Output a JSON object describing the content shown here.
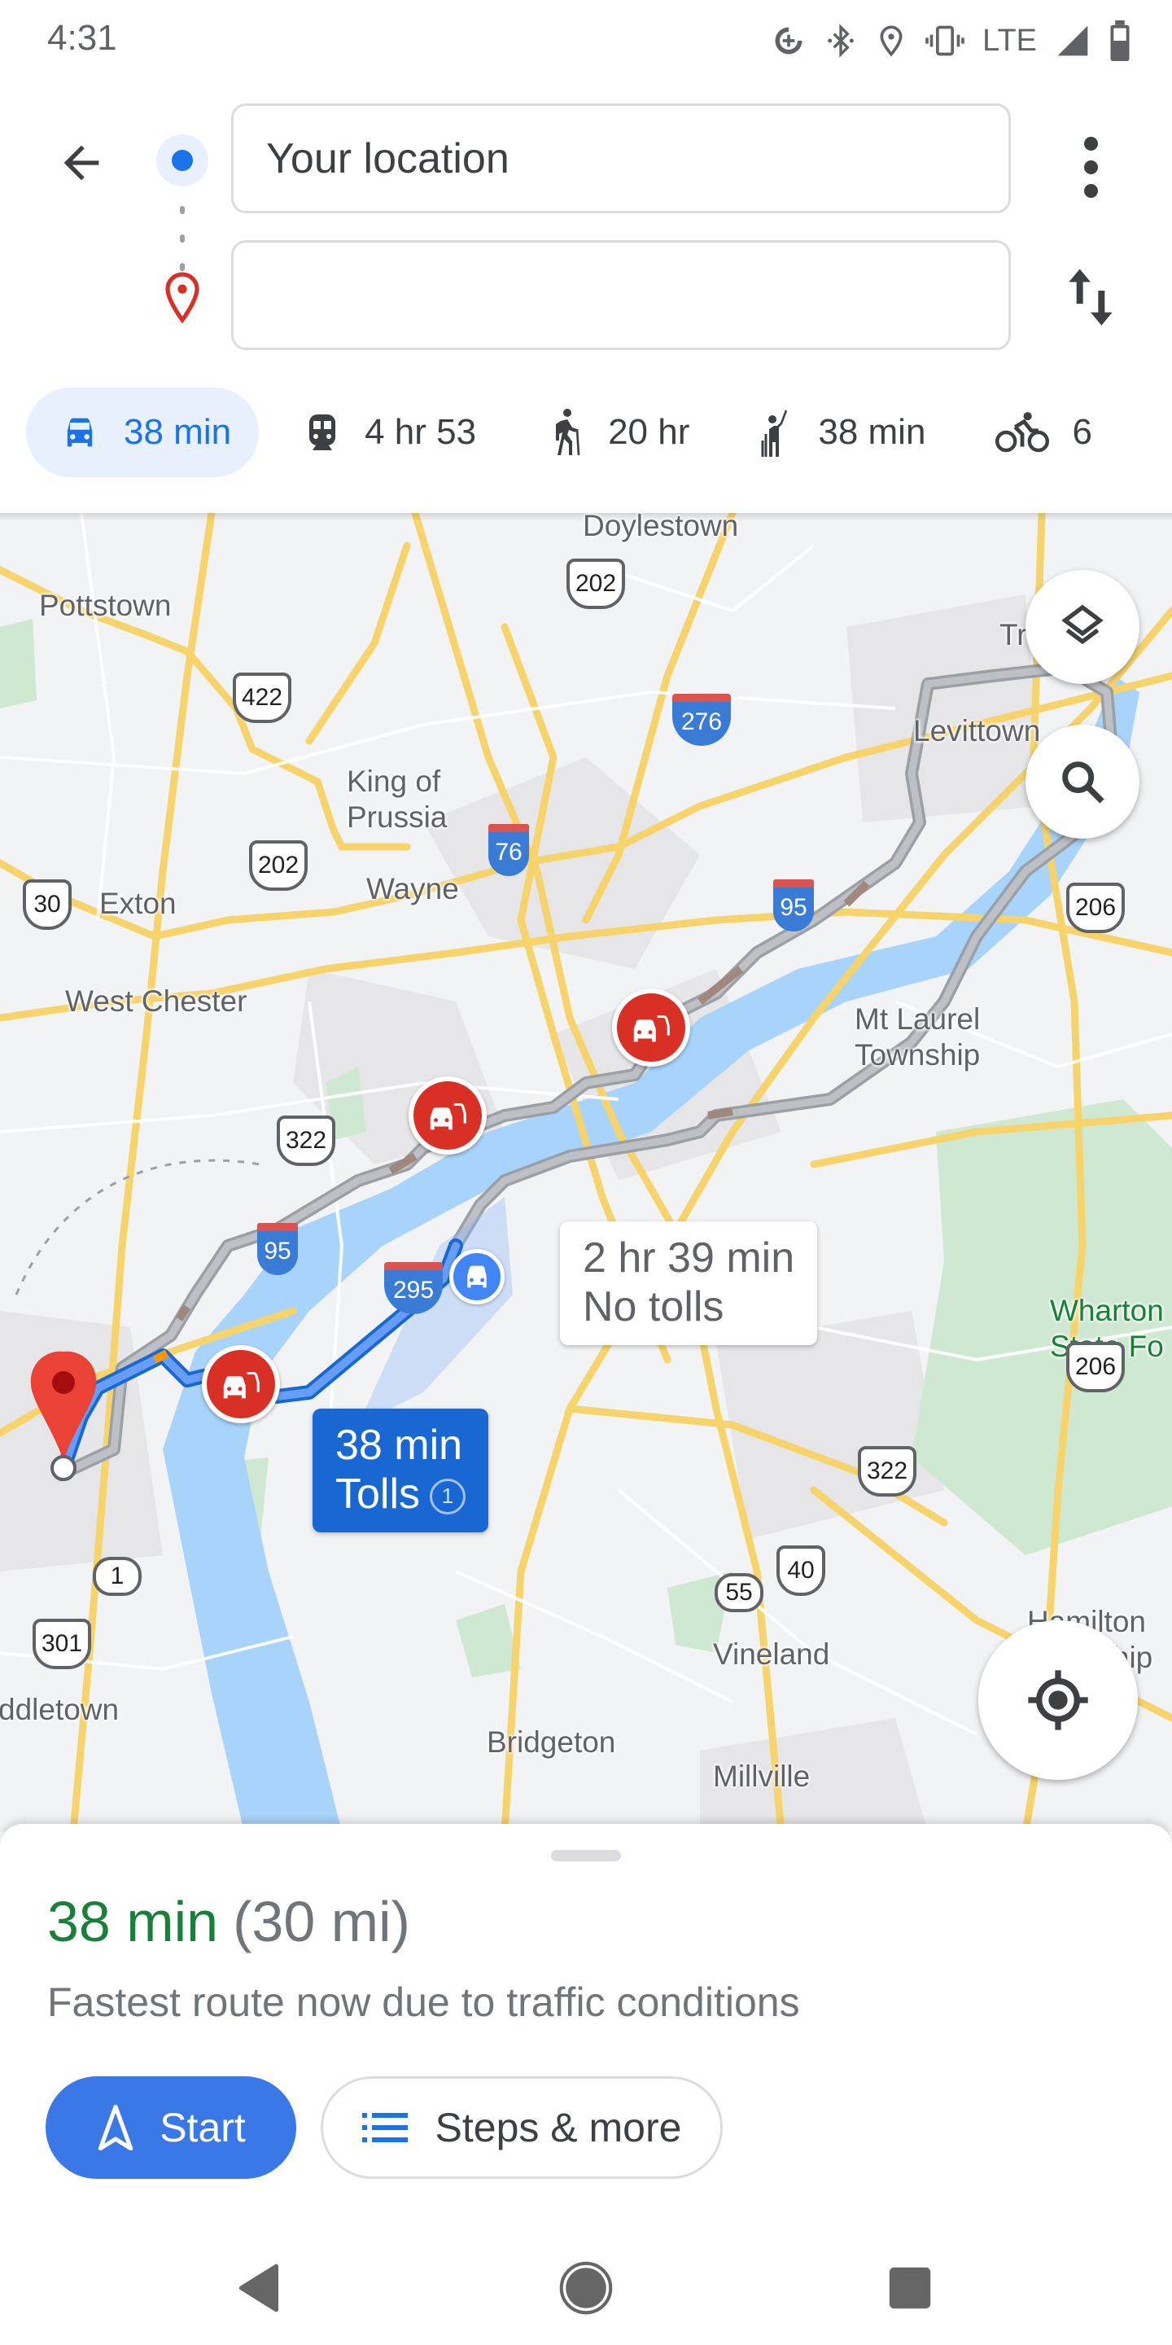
{
  "status_bar": {
    "time": "4:31",
    "network": "LTE",
    "icons": [
      "data-saver-icon",
      "bluetooth-icon",
      "location-icon",
      "vibrate-icon",
      "signal-icon",
      "battery-icon"
    ]
  },
  "header": {
    "back_icon": "arrow-back-icon",
    "origin_value": "Your location",
    "destination_value": "",
    "destination_placeholder": "",
    "more_icon": "more-vert-icon",
    "swap_icon": "swap-vert-icon"
  },
  "travel_modes": [
    {
      "mode": "driving",
      "icon": "car-icon",
      "label": "38 min",
      "selected": true
    },
    {
      "mode": "transit",
      "icon": "train-icon",
      "label": "4 hr 53",
      "selected": false
    },
    {
      "mode": "walking",
      "icon": "hiking-icon",
      "label": "20 hr",
      "selected": false
    },
    {
      "mode": "ride",
      "icon": "hail-icon",
      "label": "38 min",
      "selected": false
    },
    {
      "mode": "cycling",
      "icon": "bike-icon",
      "label": "6",
      "selected": false
    }
  ],
  "map": {
    "places": [
      {
        "name": "Doylestown"
      },
      {
        "name": "Pottstown"
      },
      {
        "name": "King of\nPrussia"
      },
      {
        "name": "Wayne"
      },
      {
        "name": "Exton"
      },
      {
        "name": "West Chester"
      },
      {
        "name": "Levittown"
      },
      {
        "name": "Tr"
      },
      {
        "name": "Mt Laurel\nTownship"
      },
      {
        "name": "Wharton\nState Fo"
      },
      {
        "name": "Vineland"
      },
      {
        "name": "Bridgeton"
      },
      {
        "name": "Millville"
      },
      {
        "name": "ddletown"
      },
      {
        "name": "Hamilton\nTownship"
      }
    ],
    "shields": [
      {
        "type": "us",
        "number": "202"
      },
      {
        "type": "us",
        "number": "422"
      },
      {
        "type": "interstate",
        "number": "276"
      },
      {
        "type": "us",
        "number": "202"
      },
      {
        "type": "interstate",
        "number": "76"
      },
      {
        "type": "us",
        "number": "30"
      },
      {
        "type": "interstate",
        "number": "95"
      },
      {
        "type": "us",
        "number": "206"
      },
      {
        "type": "us",
        "number": "322"
      },
      {
        "type": "interstate",
        "number": "95"
      },
      {
        "type": "interstate",
        "number": "295"
      },
      {
        "type": "us",
        "number": "206"
      },
      {
        "type": "us",
        "number": "322"
      },
      {
        "type": "us",
        "number": "40"
      },
      {
        "type": "state",
        "number": "55"
      },
      {
        "type": "state",
        "number": "1"
      },
      {
        "type": "us",
        "number": "301"
      }
    ],
    "routes": {
      "main": {
        "duration": "38 min",
        "note": "Tolls",
        "toll_count": "1",
        "color": "#1967d2"
      },
      "alternate": {
        "duration": "2 hr 39 min",
        "note": "No tolls",
        "color": "#9aa0a6"
      }
    },
    "buttons": {
      "layers_icon": "layers-icon",
      "search_icon": "search-icon",
      "recenter_icon": "my-location-icon"
    }
  },
  "sheet": {
    "duration": "38 min",
    "distance": "(30 mi)",
    "description": "Fastest route now due to traffic conditions",
    "start_label": "Start",
    "steps_label": "Steps & more",
    "duration_color": "#188038",
    "start_color": "#3b78e7"
  },
  "nav_bar": {
    "back_icon": "nav-back-icon",
    "home_icon": "nav-home-icon",
    "recents_icon": "nav-recents-icon"
  }
}
